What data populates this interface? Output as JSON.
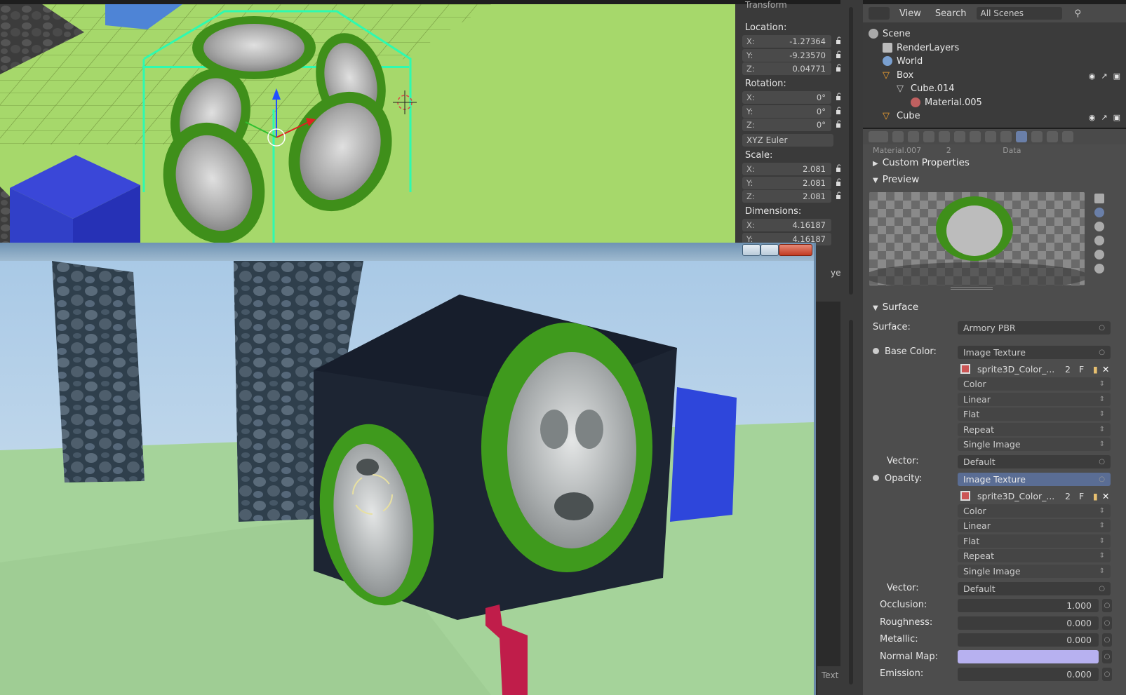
{
  "npanel": {
    "title_partial": "Transform",
    "location_label": "Location:",
    "location": [
      {
        "axis": "X:",
        "value": "-1.27364"
      },
      {
        "axis": "Y:",
        "value": "-9.23570"
      },
      {
        "axis": "Z:",
        "value": "0.04771"
      }
    ],
    "rotation_label": "Rotation:",
    "rotation": [
      {
        "axis": "X:",
        "value": "0°"
      },
      {
        "axis": "Y:",
        "value": "0°"
      },
      {
        "axis": "Z:",
        "value": "0°"
      }
    ],
    "rotation_mode": "XYZ Euler",
    "scale_label": "Scale:",
    "scale": [
      {
        "axis": "X:",
        "value": "2.081"
      },
      {
        "axis": "Y:",
        "value": "2.081"
      },
      {
        "axis": "Z:",
        "value": "2.081"
      }
    ],
    "dimensions_label": "Dimensions:",
    "dimensions": [
      {
        "axis": "X:",
        "value": "4.16187"
      },
      {
        "axis": "Y:",
        "value": "4.16187"
      }
    ],
    "clipped_text": "ye"
  },
  "outliner": {
    "menu_view": "View",
    "menu_search": "Search",
    "scene_select": "All Scenes",
    "rows": [
      {
        "label": "Scene"
      },
      {
        "label": "RenderLayers"
      },
      {
        "label": "World"
      },
      {
        "label": "Box"
      },
      {
        "label": "Cube.014"
      },
      {
        "label": "Material.005"
      },
      {
        "label": "Cube"
      }
    ]
  },
  "properties": {
    "material_partial": "Material.007",
    "users_partial": "2",
    "data_partial": "Data",
    "custom_properties": "Custom Properties",
    "preview": "Preview",
    "surface_panel": "Surface",
    "surface_label": "Surface:",
    "surface_value": "Armory PBR",
    "base_color_label": "Base Color:",
    "base_color_value": "Image Texture",
    "tex1_name": "sprite3D_Color_...",
    "tex1_users": "2",
    "tex1_fake": "F",
    "tex1_opts": [
      "Color",
      "Linear",
      "Flat",
      "Repeat",
      "Single Image"
    ],
    "vector1_label": "Vector:",
    "vector1_value": "Default",
    "opacity_label": "Opacity:",
    "opacity_value": "Image Texture",
    "tex2_name": "sprite3D_Color_...",
    "tex2_users": "2",
    "tex2_fake": "F",
    "tex2_opts": [
      "Color",
      "Linear",
      "Flat",
      "Repeat",
      "Single Image"
    ],
    "vector2_label": "Vector:",
    "vector2_value": "Default",
    "occlusion_label": "Occlusion:",
    "occlusion_value": "1.000",
    "roughness_label": "Roughness:",
    "roughness_value": "0.000",
    "metallic_label": "Metallic:",
    "metallic_value": "0.000",
    "normal_map_label": "Normal Map:",
    "emission_label": "Emission:",
    "emission_value": "0.000",
    "normal_map_color": "#b7b1f0"
  },
  "statusbar": {
    "text_partial": "Text"
  }
}
